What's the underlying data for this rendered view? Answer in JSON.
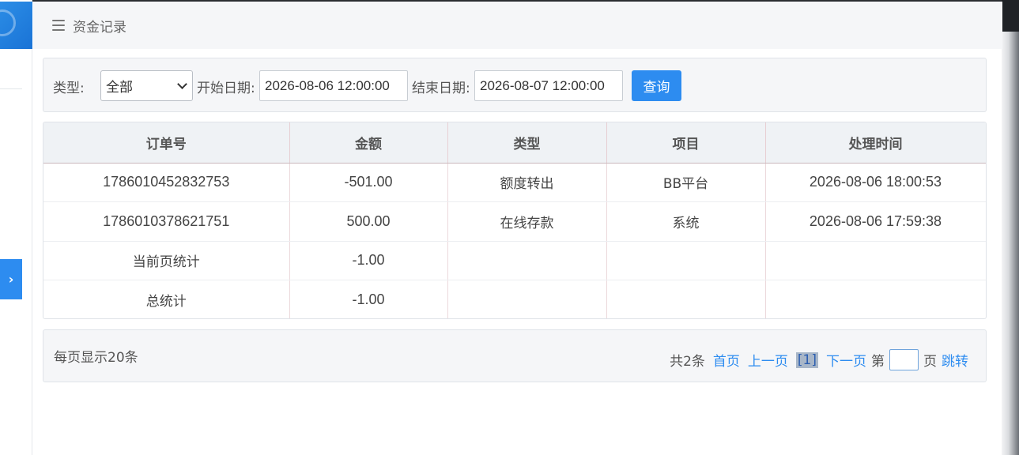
{
  "header": {
    "title": "资金记录"
  },
  "filter": {
    "type_label": "类型:",
    "type_value": "全部",
    "start_label": "开始日期:",
    "start_value": "2026-08-06 12:00:00",
    "end_label": "结束日期:",
    "end_value": "2026-08-07 12:00:00",
    "query_label": "查询"
  },
  "table": {
    "columns": [
      "订单号",
      "金额",
      "类型",
      "项目",
      "处理时间"
    ],
    "rows": [
      [
        "1786010452832753",
        "-501.00",
        "额度转出",
        "BB平台",
        "2026-08-06 18:00:53"
      ],
      [
        "1786010378621751",
        "500.00",
        "在线存款",
        "系统",
        "2026-08-06 17:59:38"
      ],
      [
        "当前页统计",
        "-1.00",
        "",
        "",
        ""
      ],
      [
        "总统计",
        "-1.00",
        "",
        "",
        ""
      ]
    ]
  },
  "pager": {
    "per_page": "每页显示20条",
    "total": "共2条",
    "first": "首页",
    "prev": "上一页",
    "current": "[1]",
    "next": "下一页",
    "page_prefix": "第",
    "page_suffix": "页",
    "jump": "跳转"
  }
}
